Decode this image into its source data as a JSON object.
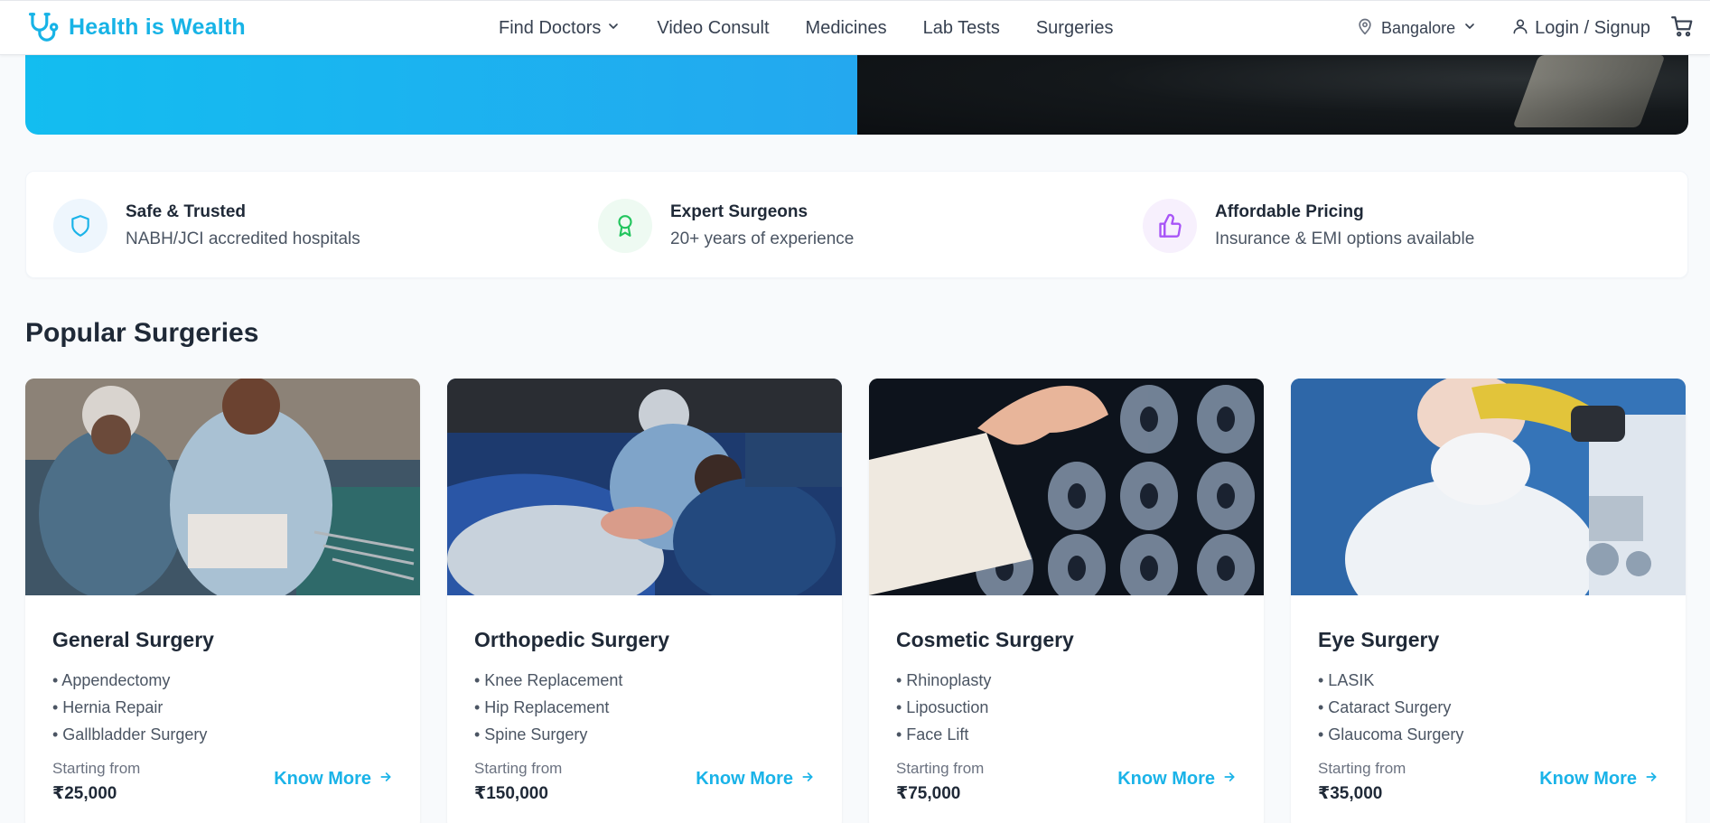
{
  "brand": {
    "name": "Health is Wealth",
    "color": "#17b3e6"
  },
  "nav": {
    "items": [
      {
        "label": "Find Doctors",
        "has_dropdown": true
      },
      {
        "label": "Video Consult",
        "has_dropdown": false
      },
      {
        "label": "Medicines",
        "has_dropdown": false
      },
      {
        "label": "Lab Tests",
        "has_dropdown": false
      },
      {
        "label": "Surgeries",
        "has_dropdown": false
      }
    ]
  },
  "header_right": {
    "location": "Bangalore",
    "login_label": "Login / Signup",
    "icons": [
      "map-pin-icon",
      "chevron-down-icon",
      "user-icon",
      "cart-icon"
    ]
  },
  "features": [
    {
      "title": "Safe & Trusted",
      "subtitle": "NABH/JCI accredited hospitals",
      "icon": "shield-icon",
      "color": "#1ab3e8"
    },
    {
      "title": "Expert Surgeons",
      "subtitle": "20+ years of experience",
      "icon": "award-icon",
      "color": "#22c55e"
    },
    {
      "title": "Affordable Pricing",
      "subtitle": "Insurance & EMI options available",
      "icon": "thumbs-up-icon",
      "color": "#a855f7"
    }
  ],
  "section": {
    "title": "Popular Surgeries"
  },
  "cards": [
    {
      "title": "General Surgery",
      "procedures": [
        "• Appendectomy",
        "• Hernia Repair",
        "• Gallbladder Surgery"
      ],
      "starting_label": "Starting from",
      "price": "₹25,000",
      "cta": "Know More"
    },
    {
      "title": "Orthopedic Surgery",
      "procedures": [
        "• Knee Replacement",
        "• Hip Replacement",
        "• Spine Surgery"
      ],
      "starting_label": "Starting from",
      "price": "₹150,000",
      "cta": "Know More"
    },
    {
      "title": "Cosmetic Surgery",
      "procedures": [
        "• Rhinoplasty",
        "• Liposuction",
        "• Face Lift"
      ],
      "starting_label": "Starting from",
      "price": "₹75,000",
      "cta": "Know More"
    },
    {
      "title": "Eye Surgery",
      "procedures": [
        "• LASIK",
        "• Cataract Surgery",
        "• Glaucoma Surgery"
      ],
      "starting_label": "Starting from",
      "price": "₹35,000",
      "cta": "Know More"
    }
  ]
}
